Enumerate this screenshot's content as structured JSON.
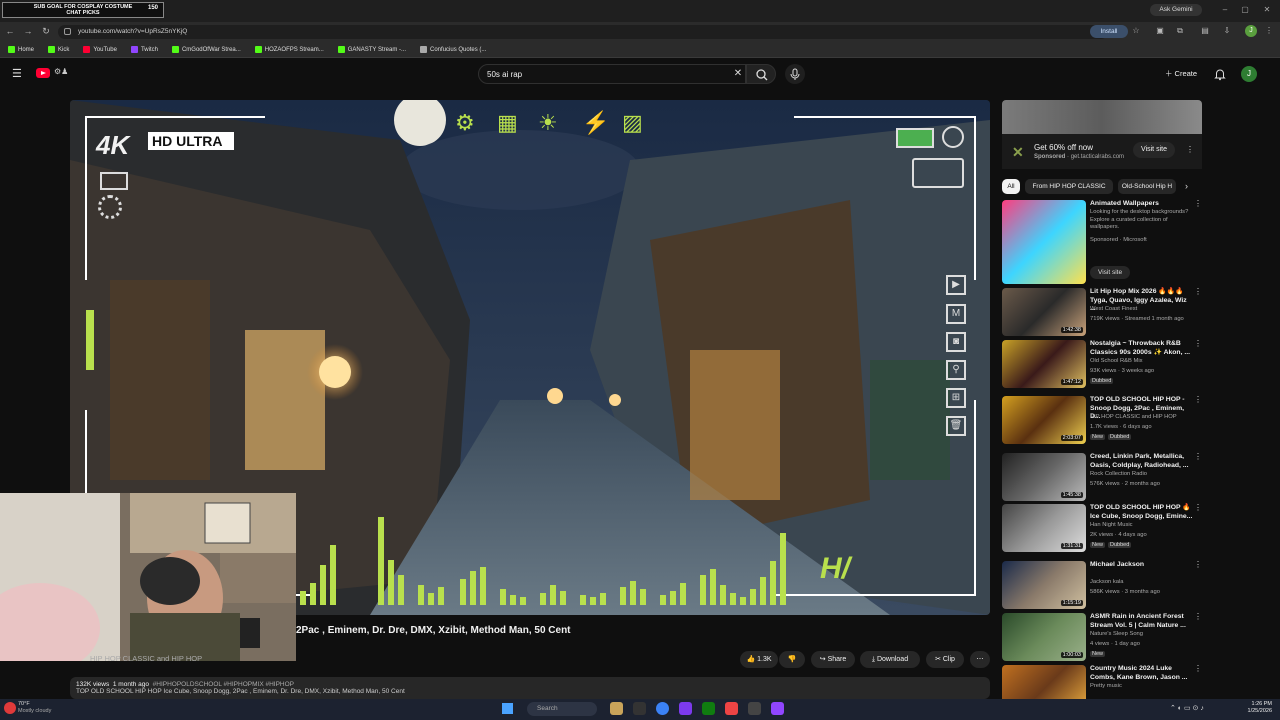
{
  "browser": {
    "url": "youtube.com/watch?v=UpRsZ5nYKjQ",
    "install_label": "Install",
    "ask_gemini_label": "Ask Gemini",
    "bookmarks": [
      {
        "label": "Home",
        "color": "#53fc18"
      },
      {
        "label": "Kick",
        "color": "#53fc18"
      },
      {
        "label": "YouTube",
        "color": "#ff0033"
      },
      {
        "label": "Twitch",
        "color": "#9146ff"
      },
      {
        "label": "CmGodOfWar Strea...",
        "color": "#53fc18"
      },
      {
        "label": "HOZAOFPS Stream...",
        "color": "#53fc18"
      },
      {
        "label": "GANASTY Stream -...",
        "color": "#53fc18"
      },
      {
        "label": "Confucius Quotes (...",
        "color": "#aaaaaa"
      }
    ],
    "profile_initial": "J"
  },
  "stream_overlay": {
    "banner_line1": "SUB GOAL FOR COSPLAY COSTUME",
    "banner_line2": "CHAT PICKS",
    "banner_count": "150"
  },
  "youtube": {
    "search_query": "50s ai rap",
    "create_label": "Create",
    "avatar_initial": "J",
    "video": {
      "hud_4k": "4K",
      "hud_hd_ultra": "HD ULTRA",
      "hud_logo": "H/",
      "title": "2Pac , Eminem, Dr. Dre, DMX, Xzibit, Method Man, 50 Cent",
      "channel": "HIP HOP CLASSIC and HIP HOP",
      "views_line": "132K views",
      "age": "1 month ago",
      "hashtags": "#HIPHOPOLDSCHOOL #HIPHOPMIX #HIPHOP",
      "description": "TOP OLD SCHOOL HIP HOP Ice Cube, Snoop Dogg, 2Pac , Eminem, Dr. Dre, DMX, Xzibit, Method Man, 50 Cent",
      "like_count": "1.3K",
      "share_label": "Share",
      "download_label": "Download",
      "clip_label": "Clip"
    },
    "ad": {
      "headline": "Get 60% off now",
      "sponsored": "Sponsored",
      "domain": "get.tacticalrabs.com",
      "cta": "Visit site"
    },
    "chips": [
      "All",
      "From HIP HOP CLASSIC",
      "Old-School Hip H"
    ],
    "recommendations": [
      {
        "title": "Animated Wallpapers",
        "desc": "Looking for the desktop backgrounds? Explore a curated collection of wallpapers.",
        "channel": "Sponsored · Microsoft",
        "meta": "",
        "cta": "Visit site",
        "colors": [
          "#ff3d7f",
          "#3dd5ff",
          "#ffe14d"
        ]
      },
      {
        "title": "Lit Hip Hop Mix 2026 🔥🔥🔥 Tyga, Quavo, Iggy Azalea, Wiz ...",
        "channel": "West Coast Finest",
        "meta": "719K views · Streamed 1 month ago",
        "duration": "1:42:38",
        "colors": [
          "#6b5a4a",
          "#2a2a2a",
          "#c9a27a"
        ]
      },
      {
        "title": "Nostalgia ~ Throwback R&B Classics 90s 2000s ✨ Akon, ...",
        "channel": "Old School R&B Mix",
        "meta": "93K views · 3 weeks ago",
        "badge": "Dubbed",
        "duration": "1:47:12",
        "colors": [
          "#c9a227",
          "#3a1a1a",
          "#e0c060"
        ]
      },
      {
        "title": "TOP OLD SCHOOL HIP HOP - Snoop Dogg, 2Pac , Eminem, D...",
        "channel": "HIP HOP CLASSIC and HIP HOP",
        "meta": "1.7K views · 6 days ago",
        "badge": "New",
        "badge2": "Dubbed",
        "duration": "2:03:07",
        "colors": [
          "#d4a020",
          "#5a3010",
          "#f0d050"
        ]
      },
      {
        "title": "Creed, Linkin Park, Metallica, Oasis, Coldplay, Radiohead, ...",
        "channel": "Rock Collection Radio",
        "meta": "576K views · 2 months ago",
        "duration": "1:45:38",
        "colors": [
          "#222222",
          "#666666",
          "#bbbbbb"
        ]
      },
      {
        "title": "TOP OLD SCHOOL HIP HOP 🔥 Ice Cube, Snoop Dogg, Emine...",
        "channel": "Han Night Music",
        "meta": "2K views · 4 days ago",
        "badge": "New",
        "badge2": "Dubbed",
        "duration": "1:31:31",
        "colors": [
          "#444444",
          "#999999",
          "#dddddd"
        ]
      },
      {
        "title": "Michael Jackson",
        "channel": "Jackson kala",
        "meta": "586K views · 3 months ago",
        "duration": "1:15:19",
        "colors": [
          "#1a2a4a",
          "#8a7a6a",
          "#d0c0a0"
        ]
      },
      {
        "title": "ASMR Rain in Ancient Forest Stream Vol. 5 | Calm Nature ...",
        "channel": "Nature's Sleep Song",
        "meta": "4 views · 1 day ago",
        "badge": "New",
        "duration": "1:00:03",
        "colors": [
          "#2a4a2a",
          "#6a8a5a",
          "#9ab08a"
        ]
      },
      {
        "title": "Country Music 2024 Luke Combs, Kane Brown, Jason ...",
        "channel": "Pretty music",
        "meta": "",
        "duration": "",
        "colors": [
          "#c07020",
          "#6a3a1a",
          "#f0b040"
        ]
      }
    ]
  },
  "taskbar": {
    "search_placeholder": "Search",
    "weather_temp": "70°F",
    "weather_desc": "Mostly cloudy",
    "time": "1:26 PM",
    "date": "1/25/2026"
  },
  "colors": {
    "yt_red": "#ff0033",
    "accent_green": "#b9e04d",
    "bg": "#0f0f0f"
  }
}
